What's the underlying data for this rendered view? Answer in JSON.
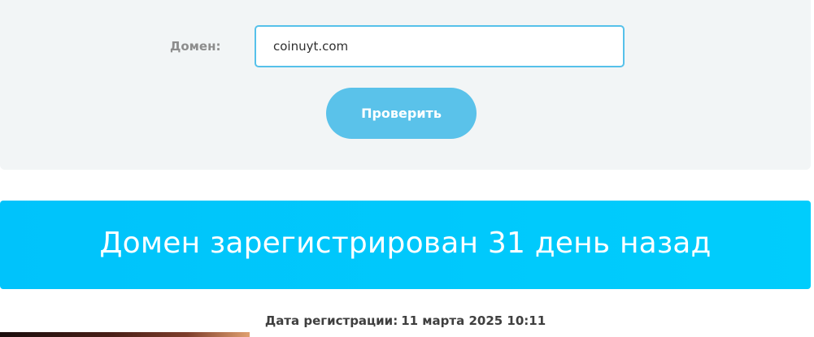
{
  "check_form": {
    "domain_label": "Домен:",
    "domain_value": "coinuyt.com",
    "button_label": "Проверить"
  },
  "result": {
    "title": "Домен зарегистрирован 31 день назад",
    "registration_label": "Дата регистрации:",
    "registration_value": "11 марта 2025 10:11"
  },
  "colors": {
    "panel_background": "#f2f5f6",
    "input_border": "#56c1ea",
    "button_background": "#5ac2ea",
    "banner_background": "#00c3fb"
  }
}
